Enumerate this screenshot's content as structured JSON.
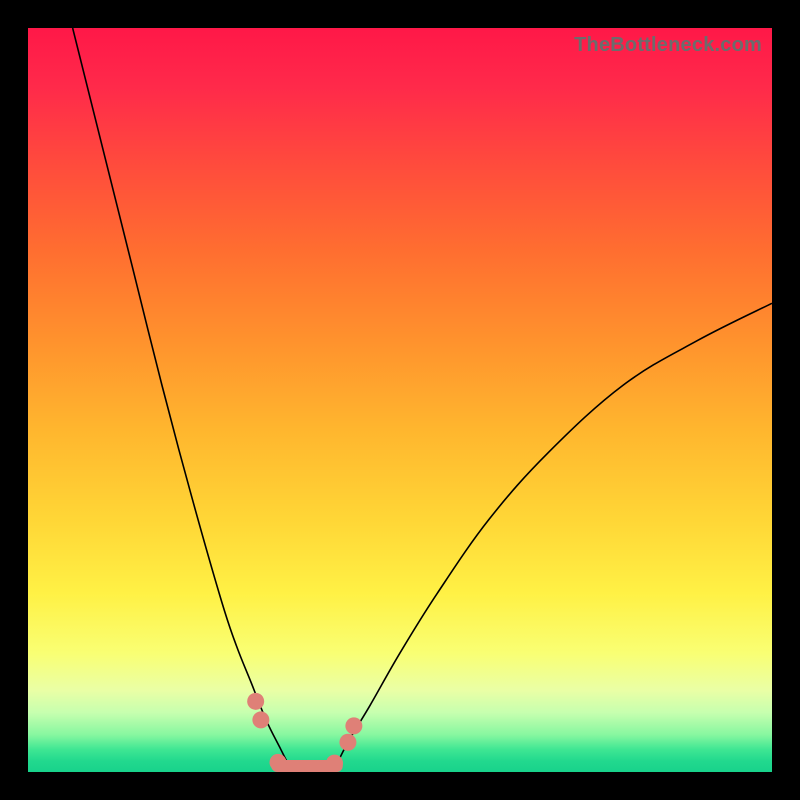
{
  "watermark": "TheBottleneck.com",
  "colors": {
    "background": "#000000",
    "curve": "#000000",
    "marker": "#df8077",
    "watermark": "#6c6c6c",
    "gradient_top": "#ff1848",
    "gradient_bottom": "#18d28b"
  },
  "chart_data": {
    "type": "line",
    "title": "",
    "xlabel": "",
    "ylabel": "",
    "xlim": [
      0,
      100
    ],
    "ylim": [
      0,
      100
    ],
    "series": [
      {
        "name": "left-curve",
        "x": [
          6,
          10,
          14,
          18,
          22,
          26,
          28,
          30,
          32,
          34,
          35.5
        ],
        "y": [
          100,
          84,
          68,
          52,
          37,
          23,
          17,
          12,
          7,
          3,
          0
        ]
      },
      {
        "name": "right-curve",
        "x": [
          41,
          43,
          46,
          50,
          55,
          62,
          70,
          80,
          90,
          100
        ],
        "y": [
          0,
          4,
          9,
          16,
          24,
          34,
          43,
          52,
          58,
          63
        ]
      },
      {
        "name": "floor-segment",
        "x": [
          33.5,
          41.5
        ],
        "y": [
          0,
          0
        ]
      }
    ],
    "markers": [
      {
        "x": 30.6,
        "y": 9.5
      },
      {
        "x": 31.3,
        "y": 7.0
      },
      {
        "x": 33.6,
        "y": 1.3
      },
      {
        "x": 36.0,
        "y": 0.4
      },
      {
        "x": 38.7,
        "y": 0.4
      },
      {
        "x": 41.2,
        "y": 1.2
      },
      {
        "x": 43.0,
        "y": 4.0
      },
      {
        "x": 43.8,
        "y": 6.2
      }
    ]
  }
}
